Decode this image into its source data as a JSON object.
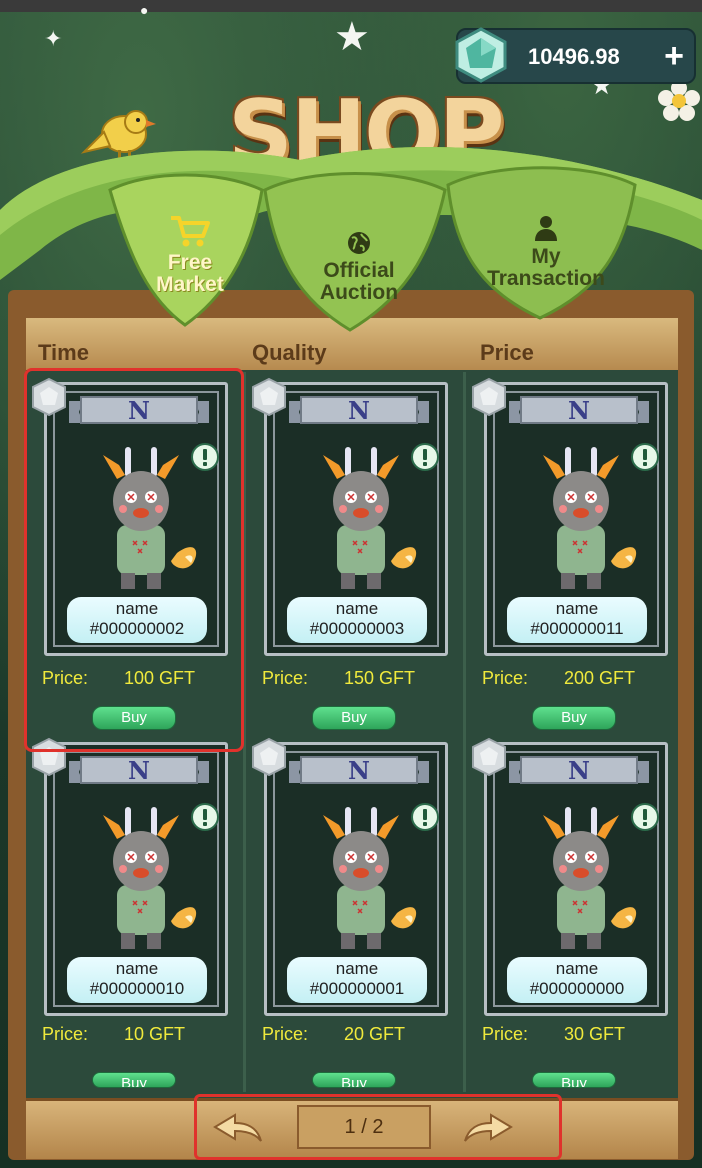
{
  "currency": {
    "amount": "10496.98",
    "plus": "+"
  },
  "title": "SHOP",
  "tabs": [
    {
      "label_line1": "Free",
      "label_line2": "Market"
    },
    {
      "label_line1": "Official",
      "label_line2": "Auction"
    },
    {
      "label_line1": "My",
      "label_line2": "Transaction"
    }
  ],
  "columns": {
    "time": "Time",
    "quality": "Quality",
    "price": "Price"
  },
  "cards": [
    {
      "rarity": "N",
      "name_line1": "name",
      "name_line2": "#000000002",
      "price_label": "Price:",
      "price": "100 GFT",
      "buy": "Buy"
    },
    {
      "rarity": "N",
      "name_line1": "name",
      "name_line2": "#000000003",
      "price_label": "Price:",
      "price": "150 GFT",
      "buy": "Buy"
    },
    {
      "rarity": "N",
      "name_line1": "name",
      "name_line2": "#000000011",
      "price_label": "Price:",
      "price": "200 GFT",
      "buy": "Buy"
    },
    {
      "rarity": "N",
      "name_line1": "name",
      "name_line2": "#000000010",
      "price_label": "Price:",
      "price": "10 GFT",
      "buy": "Buy"
    },
    {
      "rarity": "N",
      "name_line1": "name",
      "name_line2": "#000000001",
      "price_label": "Price:",
      "price": "20 GFT",
      "buy": "Buy"
    },
    {
      "rarity": "N",
      "name_line1": "name",
      "name_line2": "#000000000",
      "price_label": "Price:",
      "price": "30 GFT",
      "buy": "Buy"
    }
  ],
  "pagination": {
    "label": "1 / 2"
  },
  "colors": {
    "price_text": "#f0ea3c",
    "highlight": "#e0322c",
    "buy_button": "#3cc46e"
  }
}
